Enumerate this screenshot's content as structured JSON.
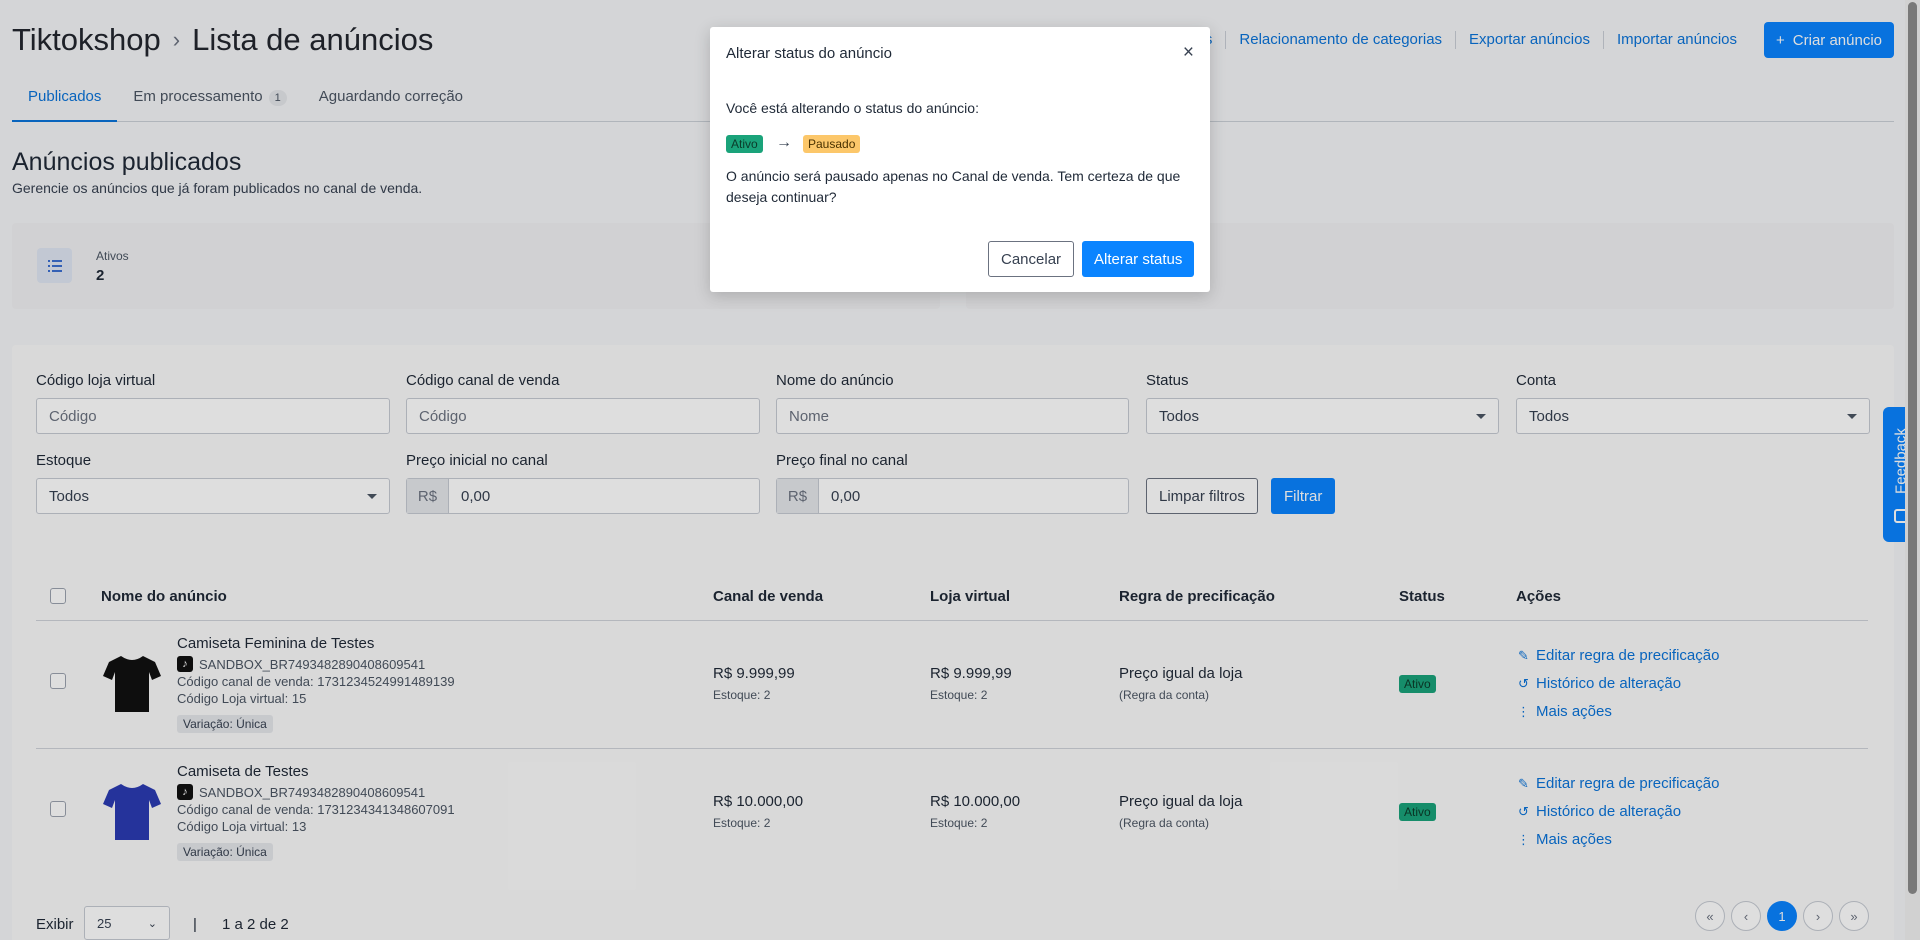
{
  "header": {
    "store": "Tiktokshop",
    "separator": "›",
    "page": "Lista de anúncios",
    "links": [
      "urações",
      "Relacionamento de categorias",
      "Exportar anúncios",
      "Importar anúncios"
    ],
    "create_label": "Criar anúncio"
  },
  "tabs": [
    {
      "label": "Publicados"
    },
    {
      "label": "Em processamento",
      "count": "1"
    },
    {
      "label": "Aguardando correção"
    }
  ],
  "section": {
    "title": "Anúncios publicados",
    "subtitle": "Gerencie os anúncios que já foram publicados no canal de venda."
  },
  "stats": {
    "label": "Ativos",
    "value": "2"
  },
  "filters": {
    "codigo_loja": {
      "label": "Código loja virtual",
      "placeholder": "Código"
    },
    "codigo_canal": {
      "label": "Código canal de venda",
      "placeholder": "Código"
    },
    "nome": {
      "label": "Nome do anúncio",
      "placeholder": "Nome"
    },
    "status": {
      "label": "Status",
      "value": "Todos"
    },
    "conta": {
      "label": "Conta",
      "value": "Todos"
    },
    "estoque": {
      "label": "Estoque",
      "value": "Todos"
    },
    "preco_inicial": {
      "label": "Preço inicial no canal",
      "prefix": "R$",
      "value": "0,00"
    },
    "preco_final": {
      "label": "Preço final no canal",
      "prefix": "R$",
      "value": "0,00"
    },
    "clear_label": "Limpar filtros",
    "filter_label": "Filtrar"
  },
  "table": {
    "headers": [
      "Nome do anúncio",
      "Canal de venda",
      "Loja virtual",
      "Regra de precificação",
      "Status",
      "Ações"
    ],
    "rows": [
      {
        "name": "Camiseta Feminina de Testes",
        "sku": "SANDBOX_BR7493482890408609541",
        "canal_code": "Código canal de venda: 1731234524991489139",
        "loja_code": "Código Loja virtual: 15",
        "variation": "Variação: Única",
        "canal_price": "R$ 9.999,99",
        "canal_stock": "Estoque: 2",
        "loja_price": "R$ 9.999,99",
        "loja_stock": "Estoque: 2",
        "rule": "Preço igual da loja",
        "rule_note": "(Regra da conta)",
        "status": "Ativo",
        "shirt_color": "#111111"
      },
      {
        "name": "Camiseta de Testes",
        "sku": "SANDBOX_BR7493482890408609541",
        "canal_code": "Código canal de venda: 1731234341348607091",
        "loja_code": "Código Loja virtual: 13",
        "variation": "Variação: Única",
        "canal_price": "R$ 10.000,00",
        "canal_stock": "Estoque: 2",
        "loja_price": "R$ 10.000,00",
        "loja_stock": "Estoque: 2",
        "rule": "Preço igual da loja",
        "rule_note": "(Regra da conta)",
        "status": "Ativo",
        "shirt_color": "#2b3bb3"
      }
    ],
    "actions": [
      "Editar regra de precificação",
      "Histórico de alteração",
      "Mais ações"
    ]
  },
  "footer": {
    "show_label": "Exibir",
    "per_page": "25",
    "divider": "|",
    "range": "1 a 2 de 2",
    "pages": [
      "«",
      "‹",
      "1",
      "›",
      "»"
    ]
  },
  "feedback_label": "Feedback",
  "modal": {
    "title": "Alterar status do anúncio",
    "close": "×",
    "text1": "Você está alterando o status do anúncio:",
    "from_status": "Ativo",
    "arrow": "→",
    "to_status": "Pausado",
    "text2": "O anúncio será pausado apenas no Canal de venda. Tem certeza de que deseja continuar?",
    "cancel_label": "Cancelar",
    "confirm_label": "Alterar status"
  },
  "colors": {
    "accent": "#0a84ff",
    "status_active": "#1aa37a",
    "status_paused": "#fcc76a"
  }
}
